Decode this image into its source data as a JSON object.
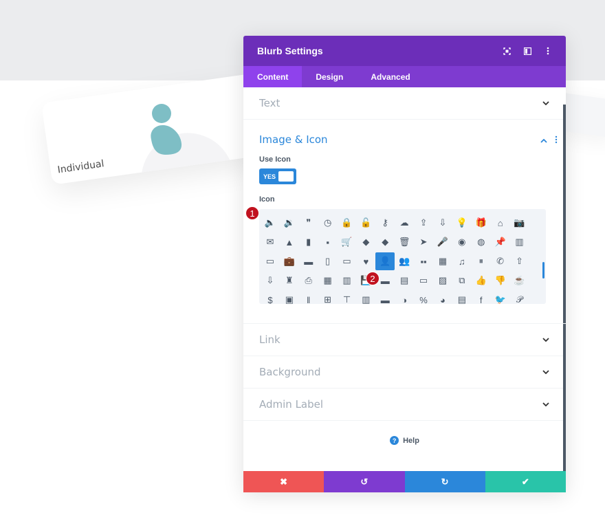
{
  "colors": {
    "header_bg": "#6c2eb9",
    "tabs_bg": "#7e3bd0",
    "active_tab_bg": "#8f42ec",
    "accent_blue": "#2b87da",
    "cancel": "#ef5555",
    "undo": "#7e3bd0",
    "redo": "#2b87da",
    "save": "#29c4a9",
    "badge": "#c1121f",
    "blurb_icon": "#7ebec5"
  },
  "preview": {
    "card_label": "Individual"
  },
  "panel": {
    "title": "Blurb Settings",
    "header_icons": [
      "fullscreen-icon",
      "split-view-icon",
      "more-options-icon"
    ],
    "tabs": [
      {
        "label": "Content",
        "active": true
      },
      {
        "label": "Design",
        "active": false
      },
      {
        "label": "Advanced",
        "active": false
      }
    ],
    "sections": {
      "text": "Text",
      "image_icon": "Image & Icon",
      "link": "Link",
      "background": "Background",
      "admin_label": "Admin Label"
    },
    "use_icon": {
      "label": "Use Icon",
      "value": "YES"
    },
    "icon_picker": {
      "label": "Icon",
      "rows": [
        [
          "🔈",
          "🔉",
          "❞",
          "◷",
          "🔒",
          "🔓",
          "⚷",
          "☁",
          "⇪",
          "⇩",
          "💡",
          "🎁",
          "⌂",
          "📷"
        ],
        [
          "✉",
          "▲",
          "▮",
          "▪",
          "🛒",
          "◆",
          "◆",
          "🗑",
          "➤",
          "🎤",
          "◉",
          "◍",
          "📌",
          "▥"
        ],
        [
          "▭",
          "💼",
          "▬",
          "▯",
          "▭",
          "♥",
          "👤",
          "👥",
          "▪▪",
          "▦",
          "♫",
          "⏸",
          "✆",
          "⇧"
        ],
        [
          "⇩",
          "♜",
          "⎙",
          "▦",
          "▥",
          "💾",
          "▬",
          "▤",
          "▭",
          "▨",
          "⧉",
          "👍",
          "👎",
          "☕"
        ],
        [
          "$",
          "▣",
          "‖",
          "⊞",
          "⊤",
          "▥",
          "▬",
          "◑",
          "%",
          "◕",
          "▤",
          "f",
          "🐦",
          "𝒫"
        ]
      ],
      "selected": {
        "row": 2,
        "col": 6,
        "name": "user-icon"
      }
    },
    "badges": [
      "1",
      "2"
    ],
    "help_label": "Help",
    "footer": {
      "cancel": "✖",
      "undo": "↺",
      "redo": "↻",
      "save": "✔"
    }
  }
}
